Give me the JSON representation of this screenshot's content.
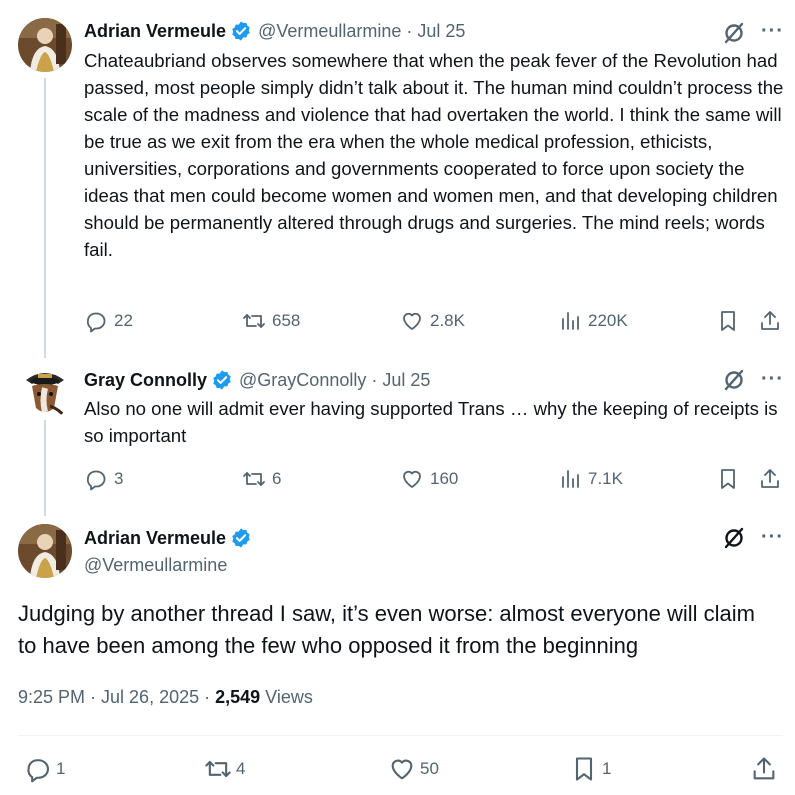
{
  "tweets": [
    {
      "name": "Adrian Vermeule",
      "handle": "@Vermeullarmine",
      "date": "· Jul 25",
      "text": "Chateaubriand observes somewhere that when the peak fever of the Revolution had passed, most people simply didn’t talk about it. The human mind couldn’t process the scale of the madness and violence that had overtaken the world. I think the same will be true as we exit from the era when the whole medical profession, ethicists, universities, corporations and governments cooperated to force upon society the ideas that men could become women and women men, and that developing children should be permanently altered through drugs and surgeries. The mind reels; words fail.",
      "replies": "22",
      "reposts": "658",
      "likes": "2.8K",
      "views": "220K"
    },
    {
      "name": "Gray Connolly",
      "handle": "@GrayConnolly",
      "date": "· Jul 25",
      "text": "Also no one will admit ever having supported Trans … why the keeping of receipts is so important",
      "replies": "3",
      "reposts": "6",
      "likes": "160",
      "views": "7.1K"
    }
  ],
  "main": {
    "name": "Adrian Vermeule",
    "handle": "@Vermeullarmine",
    "text": "Judging by another thread I saw, it’s even worse: almost everyone will claim to have been among the few who opposed it from the beginning",
    "time": "9:25 PM · Jul 26, 2025 · ",
    "views_count": "2,549",
    "views_label": " Views",
    "replies": "1",
    "reposts": "4",
    "likes": "50",
    "bookmarks": "1"
  },
  "icons": {
    "verified": "verified-badge-icon",
    "grok": "grok-icon",
    "more": "more-icon",
    "reply": "reply-icon",
    "repost": "repost-icon",
    "like": "like-icon",
    "views": "views-icon",
    "bookmark": "bookmark-icon",
    "share": "share-icon"
  },
  "colors": {
    "verified": "#1d9bf0",
    "muted": "#536471",
    "thread_line": "#cfd9de"
  }
}
